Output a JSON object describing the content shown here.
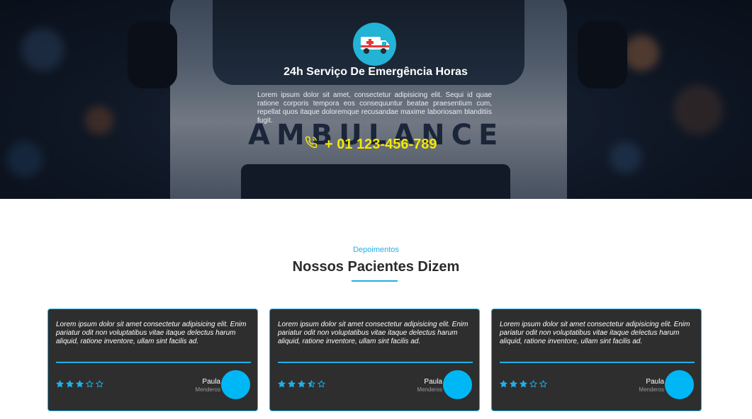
{
  "hero": {
    "icon": "ambulance-icon",
    "background_text": "AMBULANCE",
    "title": "24h Serviço De Emergência Horas",
    "description": "Lorem ipsum dolor sit amet, consectetur adipisicing elit. Sequi id quae ratione corporis tempora eos consequuntur beatae praesentium cum, repellat quos itaque doloremque recusandae maxime laboriosam blanditiis fugit.",
    "phone_icon": "phone-icon",
    "phone": "+ 01 123-456-789"
  },
  "testimonials": {
    "kicker": "Depoimentos",
    "title": "Nossos Pacientes Dizem",
    "cards": [
      {
        "quote": "Lorem ipsum dolor sit amet consectetur adipisicing elit. Enim pariatur odit non voluptatibus vitae itaque delectus harum aliquid, ratione inventore, ullam sint facilis ad.",
        "rating": 3,
        "name": "Paula",
        "subtitle": "Menderos"
      },
      {
        "quote": "Lorem ipsum dolor sit amet consectetur adipisicing elit. Enim pariatur odit non voluptatibus vitae itaque delectus harum aliquid, ratione inventore, ullam sint facilis ad.",
        "rating": 3.5,
        "name": "Paula",
        "subtitle": "Menderos"
      },
      {
        "quote": "Lorem ipsum dolor sit amet consectetur adipisicing elit. Enim pariatur odit non voluptatibus vitae itaque delectus harum aliquid, ratione inventore, ullam sint facilis ad.",
        "rating": 3,
        "name": "Paula",
        "subtitle": "Menderos"
      }
    ]
  },
  "colors": {
    "accent": "#1fb0e8",
    "phone": "#f5e800",
    "card_bg": "#2e2e2e",
    "avatar": "#00b7f5"
  }
}
